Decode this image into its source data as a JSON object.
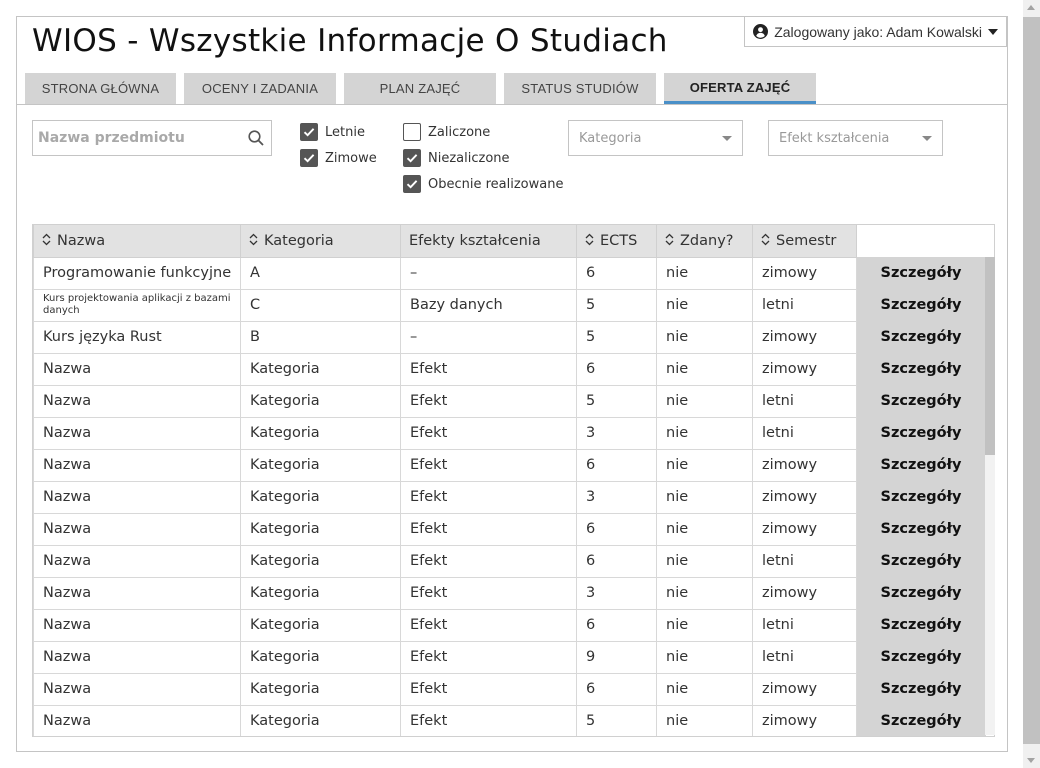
{
  "app": {
    "title": "WIOS - Wszystkie Informacje O Studiach",
    "login_label": "Zalogowany jako: Adam Kowalski"
  },
  "tabs": [
    {
      "label": "STRONA GŁÓWNA",
      "active": false
    },
    {
      "label": "OCENY I ZADANIA",
      "active": false
    },
    {
      "label": "PLAN ZAJĘĆ",
      "active": false
    },
    {
      "label": "STATUS STUDIÓW",
      "active": false
    },
    {
      "label": "OFERTA ZAJĘĆ",
      "active": true
    }
  ],
  "filters": {
    "search_placeholder": "Nazwa przedmiotu",
    "checkboxes": [
      {
        "label": "Letnie",
        "checked": true
      },
      {
        "label": "Zimowe",
        "checked": true
      },
      {
        "label": "Zaliczone",
        "checked": false
      },
      {
        "label": "Niezaliczone",
        "checked": true
      },
      {
        "label": "Obecnie realizowane",
        "checked": true
      }
    ],
    "category_select": "Kategoria",
    "effect_select": "Efekt kształcenia"
  },
  "table": {
    "headers": [
      "Nazwa",
      "Kategoria",
      "Efekty kształcenia",
      "ECTS",
      "Zdany?",
      "Semestr"
    ],
    "action_label": "Szczegóły",
    "rows": [
      [
        "Programowanie funkcyjne",
        "A",
        "–",
        "6",
        "nie",
        "zimowy"
      ],
      [
        "Kurs projektowania aplikacji z bazami danych",
        "C",
        "Bazy danych",
        "5",
        "nie",
        "letni"
      ],
      [
        "Kurs języka Rust",
        "B",
        "–",
        "5",
        "nie",
        "zimowy"
      ],
      [
        "Nazwa",
        "Kategoria",
        "Efekt",
        "6",
        "nie",
        "zimowy"
      ],
      [
        "Nazwa",
        "Kategoria",
        "Efekt",
        "5",
        "nie",
        "letni"
      ],
      [
        "Nazwa",
        "Kategoria",
        "Efekt",
        "3",
        "nie",
        "letni"
      ],
      [
        "Nazwa",
        "Kategoria",
        "Efekt",
        "6",
        "nie",
        "zimowy"
      ],
      [
        "Nazwa",
        "Kategoria",
        "Efekt",
        "3",
        "nie",
        "zimowy"
      ],
      [
        "Nazwa",
        "Kategoria",
        "Efekt",
        "6",
        "nie",
        "zimowy"
      ],
      [
        "Nazwa",
        "Kategoria",
        "Efekt",
        "6",
        "nie",
        "letni"
      ],
      [
        "Nazwa",
        "Kategoria",
        "Efekt",
        "3",
        "nie",
        "zimowy"
      ],
      [
        "Nazwa",
        "Kategoria",
        "Efekt",
        "6",
        "nie",
        "letni"
      ],
      [
        "Nazwa",
        "Kategoria",
        "Efekt",
        "9",
        "nie",
        "letni"
      ],
      [
        "Nazwa",
        "Kategoria",
        "Efekt",
        "6",
        "nie",
        "zimowy"
      ],
      [
        "Nazwa",
        "Kategoria",
        "Efekt",
        "5",
        "nie",
        "zimowy"
      ]
    ]
  }
}
